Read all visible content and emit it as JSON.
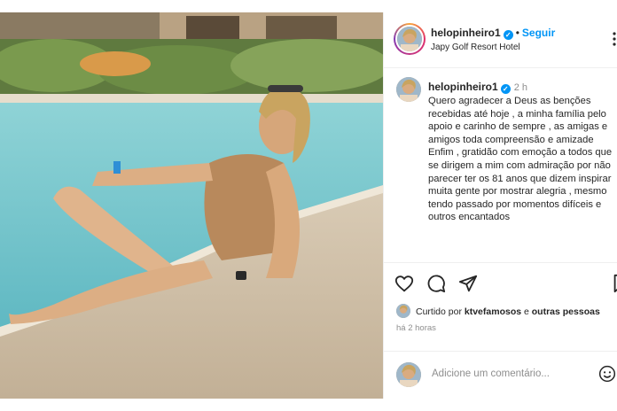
{
  "post": {
    "username": "helopinheiro1",
    "follow_label": "Seguir",
    "location": "Japy Golf Resort Hotel",
    "time_ago": "2 h",
    "caption": "Quero agradecer a Deus as benções recebidas até hoje , a minha família pelo apoio e carinho de sempre , as amigas e amigos toda compreensão e amizade Enfim , gratidão com emoção a todos que se dirigem a mim com admiração por não parecer ter os 81 anos que dizem inspirar muita gente por mostrar alegria , mesmo tendo passado por momentos difíceis e outros encantados",
    "liked_prefix": "Curtido por",
    "liked_user": "ktvefamosos",
    "liked_joiner": "e",
    "liked_others": "outras pessoas",
    "posted_when": "há 2 horas",
    "comment_placeholder": "Adicione um comentário..."
  },
  "icons": [
    "more-icon",
    "verified-icon",
    "like-icon",
    "comment-icon",
    "share-icon",
    "save-icon",
    "emoji-icon"
  ],
  "colors": {
    "accent": "#0095f6",
    "text": "#262626",
    "muted": "#8e8e8e",
    "divider": "#efefef"
  }
}
